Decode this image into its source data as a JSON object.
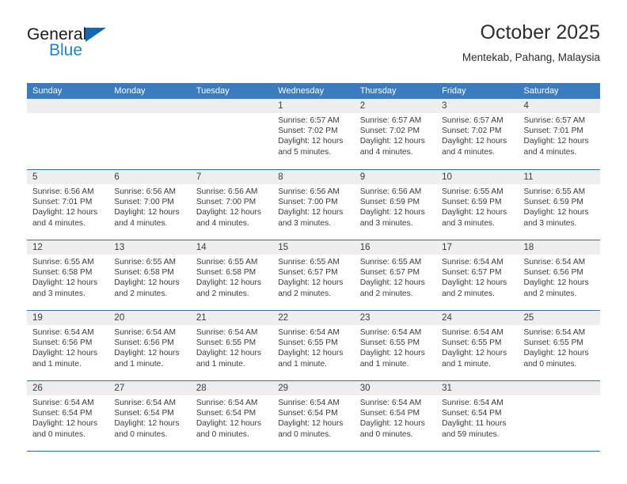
{
  "brand": {
    "name_top": "General",
    "name_bottom": "Blue",
    "accent_color": "#1b83d4",
    "triangle_color": "#1268b3"
  },
  "header": {
    "title": "October 2025",
    "subtitle": "Mentekab, Pahang, Malaysia"
  },
  "calendar": {
    "header_bg": "#3a7cbe",
    "row_divider_color": "#2f6fae",
    "date_band_bg": "#eeeeee",
    "weekdays": [
      "Sunday",
      "Monday",
      "Tuesday",
      "Wednesday",
      "Thursday",
      "Friday",
      "Saturday"
    ],
    "weeks": [
      [
        {
          "day": "",
          "sunrise": "",
          "sunset": "",
          "daylight_line1": "",
          "daylight_line2": ""
        },
        {
          "day": "",
          "sunrise": "",
          "sunset": "",
          "daylight_line1": "",
          "daylight_line2": ""
        },
        {
          "day": "",
          "sunrise": "",
          "sunset": "",
          "daylight_line1": "",
          "daylight_line2": ""
        },
        {
          "day": "1",
          "sunrise": "Sunrise: 6:57 AM",
          "sunset": "Sunset: 7:02 PM",
          "daylight_line1": "Daylight: 12 hours",
          "daylight_line2": "and 5 minutes."
        },
        {
          "day": "2",
          "sunrise": "Sunrise: 6:57 AM",
          "sunset": "Sunset: 7:02 PM",
          "daylight_line1": "Daylight: 12 hours",
          "daylight_line2": "and 4 minutes."
        },
        {
          "day": "3",
          "sunrise": "Sunrise: 6:57 AM",
          "sunset": "Sunset: 7:02 PM",
          "daylight_line1": "Daylight: 12 hours",
          "daylight_line2": "and 4 minutes."
        },
        {
          "day": "4",
          "sunrise": "Sunrise: 6:57 AM",
          "sunset": "Sunset: 7:01 PM",
          "daylight_line1": "Daylight: 12 hours",
          "daylight_line2": "and 4 minutes."
        }
      ],
      [
        {
          "day": "5",
          "sunrise": "Sunrise: 6:56 AM",
          "sunset": "Sunset: 7:01 PM",
          "daylight_line1": "Daylight: 12 hours",
          "daylight_line2": "and 4 minutes."
        },
        {
          "day": "6",
          "sunrise": "Sunrise: 6:56 AM",
          "sunset": "Sunset: 7:00 PM",
          "daylight_line1": "Daylight: 12 hours",
          "daylight_line2": "and 4 minutes."
        },
        {
          "day": "7",
          "sunrise": "Sunrise: 6:56 AM",
          "sunset": "Sunset: 7:00 PM",
          "daylight_line1": "Daylight: 12 hours",
          "daylight_line2": "and 4 minutes."
        },
        {
          "day": "8",
          "sunrise": "Sunrise: 6:56 AM",
          "sunset": "Sunset: 7:00 PM",
          "daylight_line1": "Daylight: 12 hours",
          "daylight_line2": "and 3 minutes."
        },
        {
          "day": "9",
          "sunrise": "Sunrise: 6:56 AM",
          "sunset": "Sunset: 6:59 PM",
          "daylight_line1": "Daylight: 12 hours",
          "daylight_line2": "and 3 minutes."
        },
        {
          "day": "10",
          "sunrise": "Sunrise: 6:55 AM",
          "sunset": "Sunset: 6:59 PM",
          "daylight_line1": "Daylight: 12 hours",
          "daylight_line2": "and 3 minutes."
        },
        {
          "day": "11",
          "sunrise": "Sunrise: 6:55 AM",
          "sunset": "Sunset: 6:59 PM",
          "daylight_line1": "Daylight: 12 hours",
          "daylight_line2": "and 3 minutes."
        }
      ],
      [
        {
          "day": "12",
          "sunrise": "Sunrise: 6:55 AM",
          "sunset": "Sunset: 6:58 PM",
          "daylight_line1": "Daylight: 12 hours",
          "daylight_line2": "and 3 minutes."
        },
        {
          "day": "13",
          "sunrise": "Sunrise: 6:55 AM",
          "sunset": "Sunset: 6:58 PM",
          "daylight_line1": "Daylight: 12 hours",
          "daylight_line2": "and 2 minutes."
        },
        {
          "day": "14",
          "sunrise": "Sunrise: 6:55 AM",
          "sunset": "Sunset: 6:58 PM",
          "daylight_line1": "Daylight: 12 hours",
          "daylight_line2": "and 2 minutes."
        },
        {
          "day": "15",
          "sunrise": "Sunrise: 6:55 AM",
          "sunset": "Sunset: 6:57 PM",
          "daylight_line1": "Daylight: 12 hours",
          "daylight_line2": "and 2 minutes."
        },
        {
          "day": "16",
          "sunrise": "Sunrise: 6:55 AM",
          "sunset": "Sunset: 6:57 PM",
          "daylight_line1": "Daylight: 12 hours",
          "daylight_line2": "and 2 minutes."
        },
        {
          "day": "17",
          "sunrise": "Sunrise: 6:54 AM",
          "sunset": "Sunset: 6:57 PM",
          "daylight_line1": "Daylight: 12 hours",
          "daylight_line2": "and 2 minutes."
        },
        {
          "day": "18",
          "sunrise": "Sunrise: 6:54 AM",
          "sunset": "Sunset: 6:56 PM",
          "daylight_line1": "Daylight: 12 hours",
          "daylight_line2": "and 2 minutes."
        }
      ],
      [
        {
          "day": "19",
          "sunrise": "Sunrise: 6:54 AM",
          "sunset": "Sunset: 6:56 PM",
          "daylight_line1": "Daylight: 12 hours",
          "daylight_line2": "and 1 minute."
        },
        {
          "day": "20",
          "sunrise": "Sunrise: 6:54 AM",
          "sunset": "Sunset: 6:56 PM",
          "daylight_line1": "Daylight: 12 hours",
          "daylight_line2": "and 1 minute."
        },
        {
          "day": "21",
          "sunrise": "Sunrise: 6:54 AM",
          "sunset": "Sunset: 6:55 PM",
          "daylight_line1": "Daylight: 12 hours",
          "daylight_line2": "and 1 minute."
        },
        {
          "day": "22",
          "sunrise": "Sunrise: 6:54 AM",
          "sunset": "Sunset: 6:55 PM",
          "daylight_line1": "Daylight: 12 hours",
          "daylight_line2": "and 1 minute."
        },
        {
          "day": "23",
          "sunrise": "Sunrise: 6:54 AM",
          "sunset": "Sunset: 6:55 PM",
          "daylight_line1": "Daylight: 12 hours",
          "daylight_line2": "and 1 minute."
        },
        {
          "day": "24",
          "sunrise": "Sunrise: 6:54 AM",
          "sunset": "Sunset: 6:55 PM",
          "daylight_line1": "Daylight: 12 hours",
          "daylight_line2": "and 1 minute."
        },
        {
          "day": "25",
          "sunrise": "Sunrise: 6:54 AM",
          "sunset": "Sunset: 6:55 PM",
          "daylight_line1": "Daylight: 12 hours",
          "daylight_line2": "and 0 minutes."
        }
      ],
      [
        {
          "day": "26",
          "sunrise": "Sunrise: 6:54 AM",
          "sunset": "Sunset: 6:54 PM",
          "daylight_line1": "Daylight: 12 hours",
          "daylight_line2": "and 0 minutes."
        },
        {
          "day": "27",
          "sunrise": "Sunrise: 6:54 AM",
          "sunset": "Sunset: 6:54 PM",
          "daylight_line1": "Daylight: 12 hours",
          "daylight_line2": "and 0 minutes."
        },
        {
          "day": "28",
          "sunrise": "Sunrise: 6:54 AM",
          "sunset": "Sunset: 6:54 PM",
          "daylight_line1": "Daylight: 12 hours",
          "daylight_line2": "and 0 minutes."
        },
        {
          "day": "29",
          "sunrise": "Sunrise: 6:54 AM",
          "sunset": "Sunset: 6:54 PM",
          "daylight_line1": "Daylight: 12 hours",
          "daylight_line2": "and 0 minutes."
        },
        {
          "day": "30",
          "sunrise": "Sunrise: 6:54 AM",
          "sunset": "Sunset: 6:54 PM",
          "daylight_line1": "Daylight: 12 hours",
          "daylight_line2": "and 0 minutes."
        },
        {
          "day": "31",
          "sunrise": "Sunrise: 6:54 AM",
          "sunset": "Sunset: 6:54 PM",
          "daylight_line1": "Daylight: 11 hours",
          "daylight_line2": "and 59 minutes."
        },
        {
          "day": "",
          "sunrise": "",
          "sunset": "",
          "daylight_line1": "",
          "daylight_line2": ""
        }
      ]
    ]
  }
}
